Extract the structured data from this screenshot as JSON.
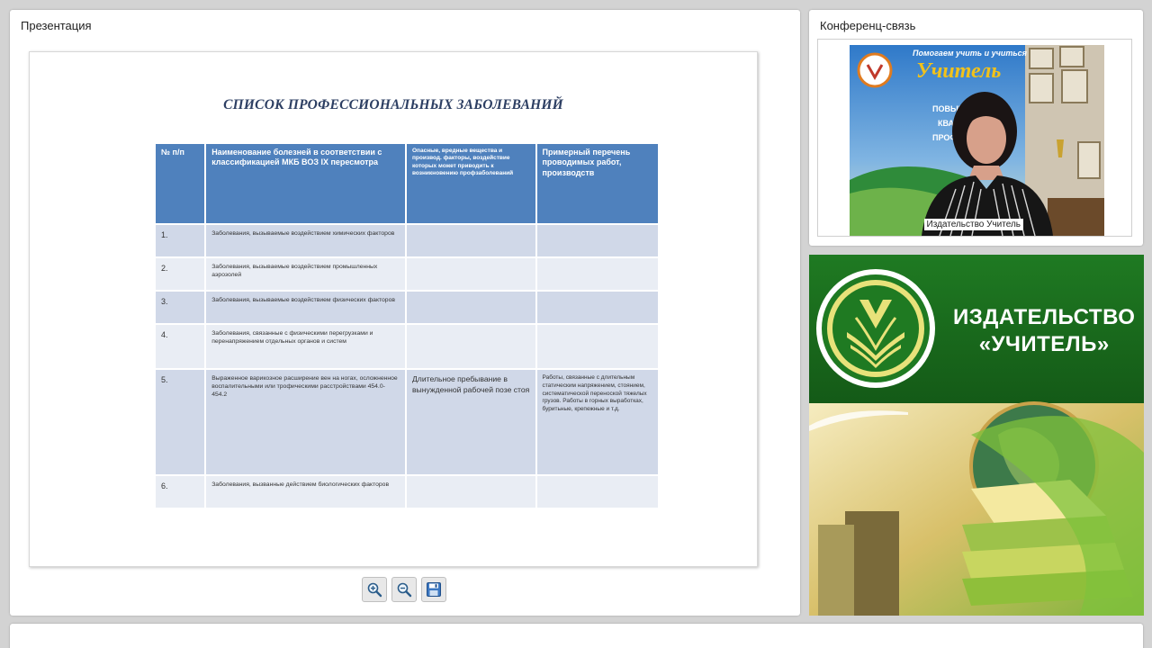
{
  "presentation": {
    "title": "Презентация",
    "slide": {
      "title": "СПИСОК ПРОФЕССИОНАЛЬНЫХ ЗАБОЛЕВАНИЙ",
      "headers": [
        "№ п/п",
        "Наименование болезней в соответствии с классификацией МКБ ВОЗ IX пересмотра",
        "Опасные, вредные вещества и производ. факторы, воздействие которых может приводить к возникновению профзаболеваний",
        "Примерный перечень проводимых работ, производств"
      ],
      "rows": [
        {
          "num": "1.",
          "disease": "Заболевания, вызываемые воздействием химических факторов",
          "factors": "",
          "works": ""
        },
        {
          "num": "2.",
          "disease": "Заболевания, вызываемые воздействием промышленных аэрозолей",
          "factors": "",
          "works": ""
        },
        {
          "num": "3.",
          "disease": "Заболевания, вызываемые воздействием физических факторов",
          "factors": "",
          "works": ""
        },
        {
          "num": "4.",
          "disease": "Заболевания, связанные с физическими перегрузками и перенапряжением отдельных органов и систем",
          "factors": "",
          "works": ""
        },
        {
          "num": "5.",
          "disease": "Выраженное варикозное расширение вен на ногах, осложненное воспалительными или трофическими расстройствами 454.0-454.2",
          "factors": "Длительное пребывание в вынужденной рабочей позе стоя",
          "works": "Работы, связанные с длительным статическим напряжением, стоянием, систематической переноской тяжелых грузов. Работы в горных выработках, буритьные, крепежные и т.д."
        },
        {
          "num": "6.",
          "disease": "Заболевания, вызванные действием биологических факторов",
          "factors": "",
          "works": ""
        }
      ]
    },
    "toolbar": {
      "zoom_in": "zoom-in-icon",
      "zoom_out": "zoom-out-icon",
      "save": "save-icon"
    }
  },
  "conference": {
    "title": "Конференц-связь",
    "participant_label": "Издательство Учитель",
    "backdrop_text": {
      "slogan": "Помогаем учить и учиться",
      "brand": "Учитель",
      "line1": "ПОВЫШЕНИ",
      "line2": "КВАЛИ",
      "line3": "ПРОФ"
    }
  },
  "banner": {
    "line1": "ИЗДАТЕЛЬСТВО",
    "line2": "«УЧИТЕЛЬ»",
    "colors": {
      "green_dark": "#1e6b1e",
      "green_light": "#8fc43c",
      "cream": "#f4e9b0"
    }
  }
}
